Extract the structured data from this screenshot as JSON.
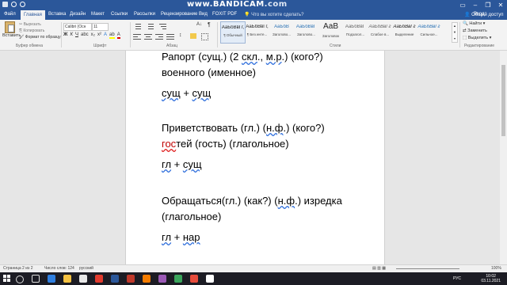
{
  "watermark": {
    "www": "www.",
    "brand": "BANDICAM",
    "com": ".com"
  },
  "tabs": [
    "Файл",
    "Главная",
    "Вставка",
    "Дизайн",
    "Макет",
    "Ссылки",
    "Рассылки",
    "Рецензирование",
    "Вид",
    "FOXIT PDF"
  ],
  "tell_me": "Что вы хотите сделать?",
  "sign_in": "Вход",
  "share": "Общий доступ",
  "ribbon": {
    "paste": "Вставить",
    "cut": "Вырезать",
    "copy": "Копировать",
    "format_painter": "Формат по образцу",
    "font_name": "Calibri (Осн",
    "font_size": "11",
    "groups": {
      "clipboard": "Буфер обмена",
      "font": "Шрифт",
      "paragraph": "Абзац",
      "styles": "Стили",
      "editing": "Редактирование"
    },
    "styles": [
      {
        "sample": "АаБбВвГг,",
        "name": "¶ Обычный"
      },
      {
        "sample": "АаБбВвГг,",
        "name": "¶ Без инте..."
      },
      {
        "sample": "АаБбВ",
        "name": "Заголово..."
      },
      {
        "sample": "АаБбВвГ",
        "name": "Заголово..."
      },
      {
        "sample": "АаВ",
        "name": "Заголовок"
      },
      {
        "sample": "АаБбВвГ",
        "name": "Подзагол..."
      },
      {
        "sample": "АаБбВвГг",
        "name": "Слабое в..."
      },
      {
        "sample": "АаБбВвГг",
        "name": "Выделение"
      },
      {
        "sample": "АаБбВвГг",
        "name": "Сильное..."
      },
      {
        "sample": "АаБбВвГг",
        "name": "Строгий"
      },
      {
        "sample": "АаБбВвГг",
        "name": ""
      }
    ],
    "find": "Найти",
    "replace": "Заменить",
    "select": "Выделить"
  },
  "document": {
    "p1_l1": {
      "a": "Рапорт (сущ.) (2 ",
      "b": "скл",
      "c": "., ",
      "d": "м.р",
      "e": ".) (кого?)"
    },
    "p1_l2": "военного (именное)",
    "p1_l3": {
      "a": "сущ",
      " b": " + ",
      "c": "сущ"
    },
    "p2_l1": {
      "a": "Приветствовать (гл.) (",
      "b": "н.ф",
      "c": ".) (кого?)"
    },
    "p2_l2": {
      "a": "гос",
      "b": "тей (гость) (глагольное)"
    },
    "p2_l3": {
      "a": "гл",
      " b": " + ",
      "c": "сущ"
    },
    "p3_l1": {
      "a": "Обращаться(гл.) (как?) (",
      "b": "н.ф",
      "c": ".) изредка"
    },
    "p3_l2": "(глагольное)",
    "p3_l3": {
      "a": "гл",
      " b": " + ",
      "c": "нар"
    }
  },
  "status": {
    "page": "Страница 2 из 2",
    "words": "Число слов: 124",
    "lang": "русский",
    "zoom": "100%"
  },
  "taskbar": {
    "lang": "РУС",
    "time": "10:02",
    "date": "03.11.2021"
  }
}
